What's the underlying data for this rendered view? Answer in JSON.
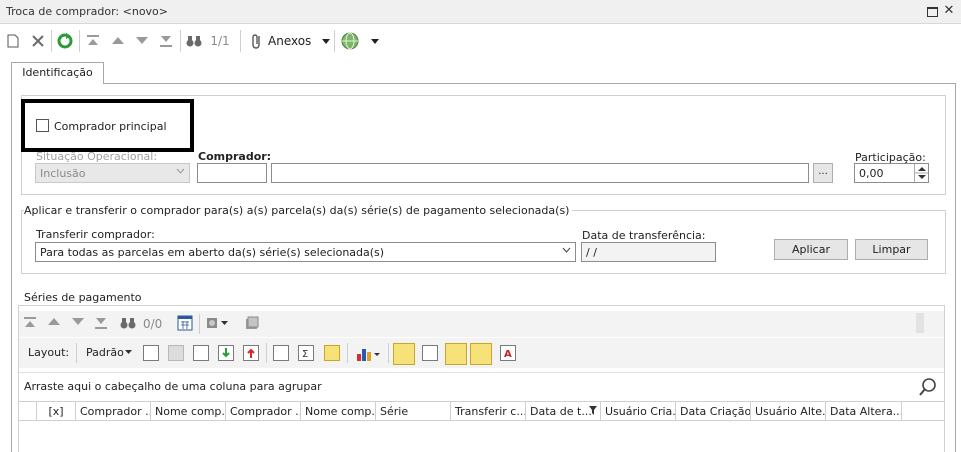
{
  "window": {
    "title": "Troca de comprador: <novo>",
    "close_glyph": "✕"
  },
  "toolbar": {
    "record_counter": "1/1",
    "attachments_label": "Anexos"
  },
  "tabs": [
    {
      "label": "Identificação"
    }
  ],
  "identification": {
    "main_buyer_label": "Comprador principal",
    "main_buyer_checked": false,
    "operational_status_label": "Situação Operacional:",
    "operational_status_value": "Inclusão",
    "buyer_label": "Comprador:",
    "buyer_code": "",
    "buyer_name": "",
    "lookup_button": "...",
    "participation_label": "Participação:",
    "participation_value": "0,00"
  },
  "transfer": {
    "section_title": "Aplicar e transferir o comprador para(s) a(s) parcela(s) da(s) série(s) de pagamento selecionada(s)",
    "transfer_buyer_label": "Transferir comprador:",
    "transfer_buyer_value": "Para todas as parcelas em aberto da(s) série(s) selecionada(s)",
    "transfer_date_label": "Data de transferência:",
    "transfer_date_value": " / /",
    "apply_button": "Aplicar",
    "clear_button": "Limpar"
  },
  "series": {
    "section_title": "Séries de pagamento",
    "record_counter": "0/0",
    "layout_label": "Layout:",
    "layout_value": "Padrão",
    "group_hint": "Arraste aqui o cabeçalho de uma coluna para agrupar",
    "columns": [
      "[x]",
      "Comprador ...",
      "Nome comp...",
      "Comprador ...",
      "Nome comp...",
      "Série",
      "Transferir c...",
      "Data de t...",
      "Usuário Cria...",
      "Data Criação",
      "Usuário Alte...",
      "Data Altera..."
    ]
  },
  "colors": {
    "accent": "#1a6fb8",
    "highlight_border": "#000000",
    "toggle_active": "#f7e27a"
  }
}
